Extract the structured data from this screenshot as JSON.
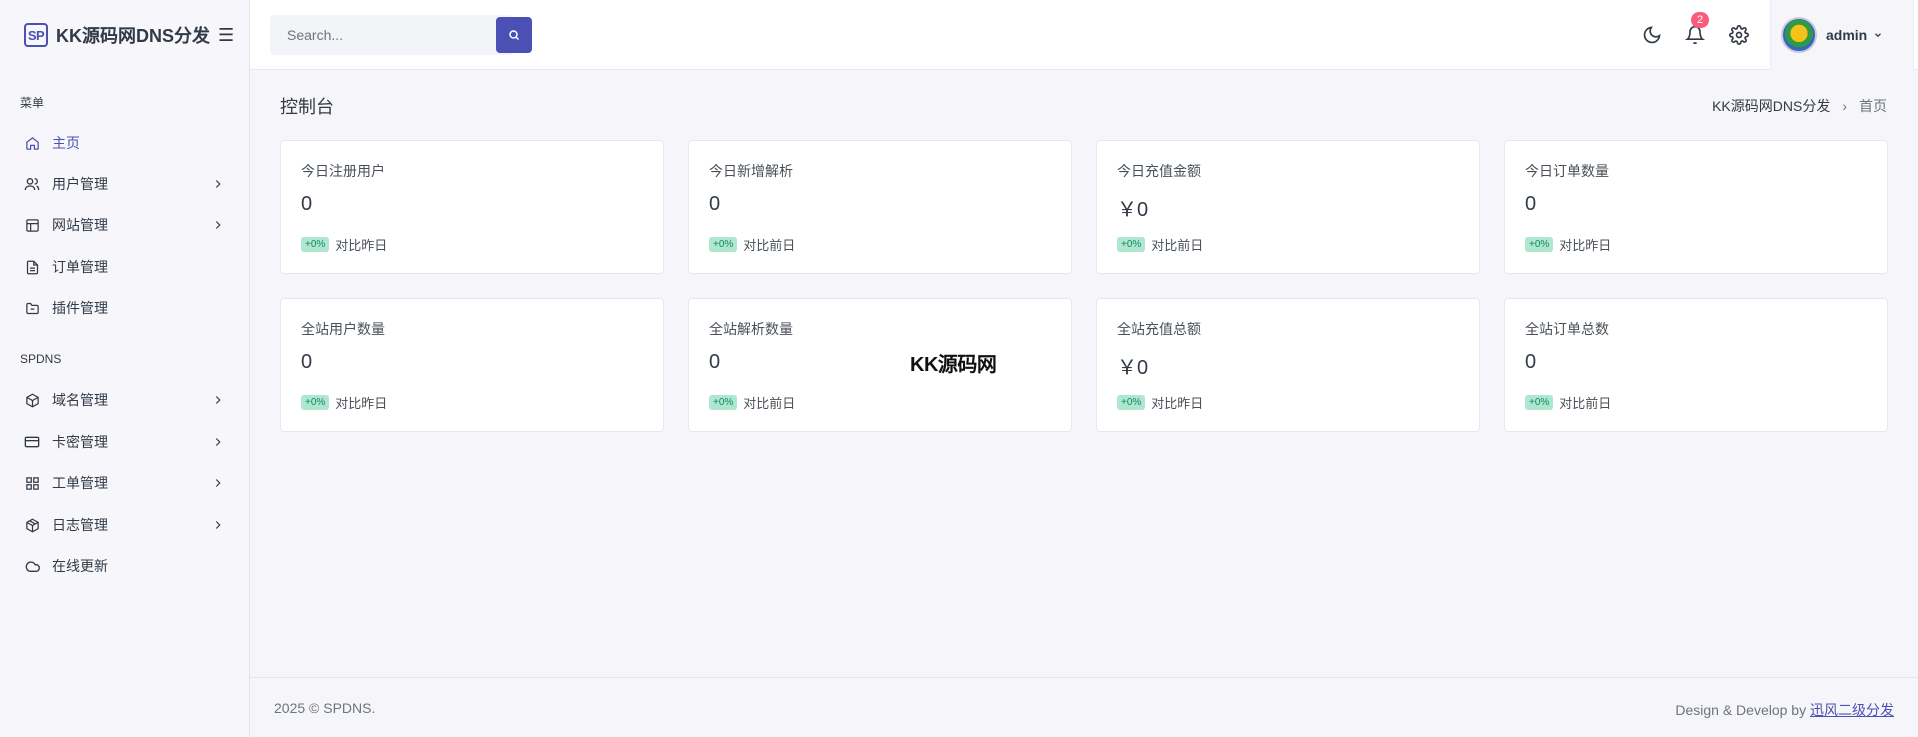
{
  "brand": {
    "logo_text": "SP",
    "name": "KK源码网DNS分发"
  },
  "sidebar": {
    "section_menu": "菜单",
    "section_spdns": "SPDNS",
    "items": [
      {
        "label": "主页",
        "icon": "home-icon",
        "active": true,
        "has_arrow": false
      },
      {
        "label": "用户管理",
        "icon": "users-icon",
        "has_arrow": true
      },
      {
        "label": "网站管理",
        "icon": "layout-icon",
        "has_arrow": true
      },
      {
        "label": "订单管理",
        "icon": "file-icon",
        "has_arrow": false
      },
      {
        "label": "插件管理",
        "icon": "folder-icon",
        "has_arrow": false
      },
      {
        "label": "域名管理",
        "icon": "box-icon",
        "has_arrow": true
      },
      {
        "label": "卡密管理",
        "icon": "credit-card-icon",
        "has_arrow": true
      },
      {
        "label": "工单管理",
        "icon": "grid-icon",
        "has_arrow": true
      },
      {
        "label": "日志管理",
        "icon": "package-icon",
        "has_arrow": true
      },
      {
        "label": "在线更新",
        "icon": "cloud-icon",
        "has_arrow": false
      }
    ]
  },
  "search": {
    "placeholder": "Search..."
  },
  "topbar": {
    "notification_count": "2",
    "user_name": "admin"
  },
  "page": {
    "title": "控制台",
    "breadcrumb": [
      "KK源码网DNS分发",
      "首页"
    ]
  },
  "stats": [
    {
      "title": "今日注册用户",
      "value": "0",
      "change": "+0%",
      "compare": "对比昨日"
    },
    {
      "title": "今日新增解析",
      "value": "0",
      "change": "+0%",
      "compare": "对比前日"
    },
    {
      "title": "今日充值金额",
      "value": "￥0",
      "change": "+0%",
      "compare": "对比前日"
    },
    {
      "title": "今日订单数量",
      "value": "0",
      "change": "+0%",
      "compare": "对比昨日"
    },
    {
      "title": "全站用户数量",
      "value": "0",
      "change": "+0%",
      "compare": "对比昨日"
    },
    {
      "title": "全站解析数量",
      "value": "0",
      "change": "+0%",
      "compare": "对比前日"
    },
    {
      "title": "全站充值总额",
      "value": "￥0",
      "change": "+0%",
      "compare": "对比昨日"
    },
    {
      "title": "全站订单总数",
      "value": "0",
      "change": "+0%",
      "compare": "对比前日"
    }
  ],
  "watermark": "KK源码网",
  "footer": {
    "copyright": "2025 © SPDNS.",
    "credit_prefix": "Design & Develop by ",
    "credit_link": "迅风二级分发"
  },
  "colors": {
    "accent": "#4b50b4",
    "badge": "#fa5c7c",
    "positive": "#0f8a5f"
  }
}
